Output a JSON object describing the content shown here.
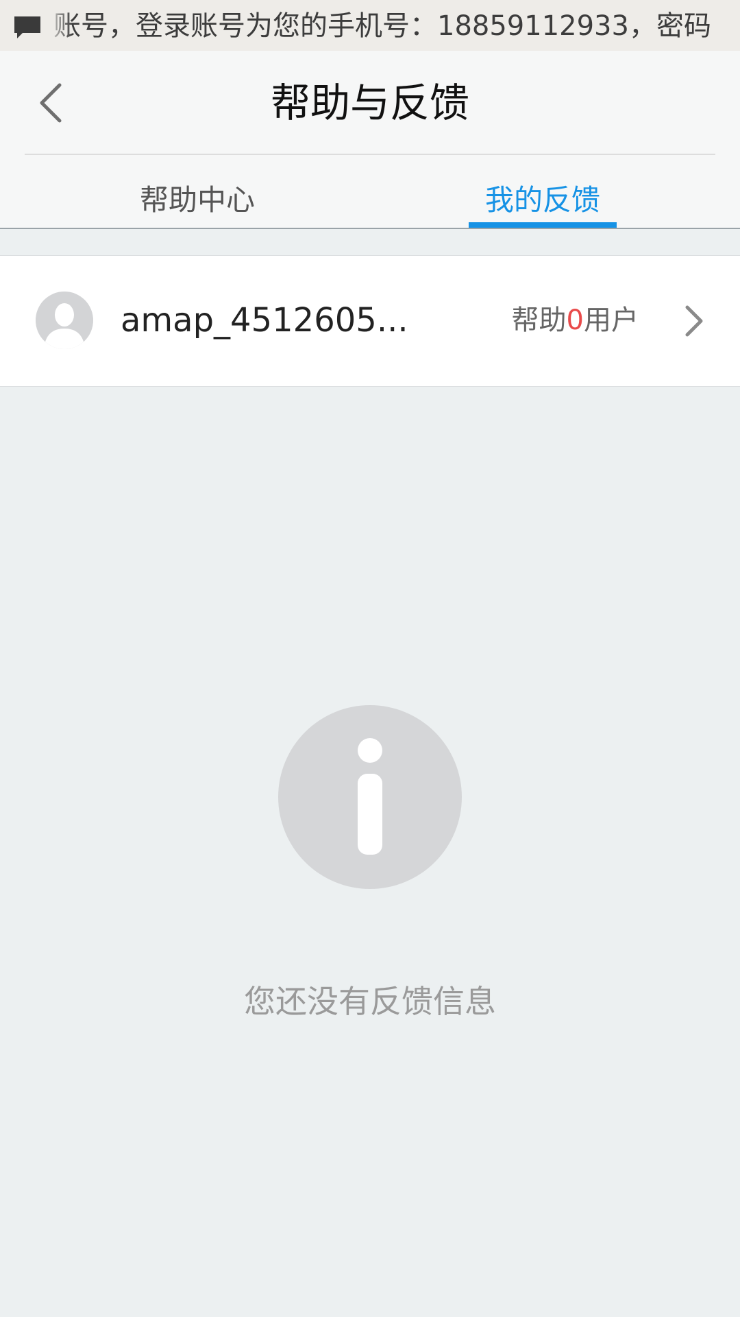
{
  "notification": {
    "icon": "message-icon",
    "text": "账号，登录账号为您的手机号：18859112933，密码"
  },
  "header": {
    "back_icon": "chevron-left-icon",
    "title": "帮助与反馈",
    "tabs": [
      {
        "label": "帮助中心",
        "selected": false
      },
      {
        "label": "我的反馈",
        "selected": true
      }
    ]
  },
  "user_row": {
    "avatar_icon": "default-avatar-icon",
    "username": "amap_4512605...",
    "help_prefix": "帮助",
    "help_count": "0",
    "help_suffix": "用户",
    "chevron_icon": "chevron-right-icon"
  },
  "empty_state": {
    "icon": "info-icon",
    "message": "您还没有反馈信息"
  },
  "colors": {
    "accent": "#1692e5",
    "count_highlight": "#e94a4a",
    "background": "#ecf0f1"
  }
}
